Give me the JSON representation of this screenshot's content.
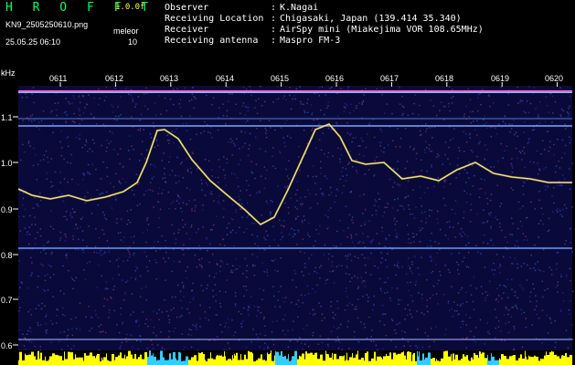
{
  "header": {
    "app_title": "H R O F F T",
    "version": "1.0.0f",
    "filename": "KN9_2505250610.png",
    "timestamp": "25.05.25 06:10",
    "meleor_label": "meleor",
    "meleor_value": "10"
  },
  "info": [
    {
      "label": "Observer",
      "value": "K.Nagai"
    },
    {
      "label": "Receiving Location",
      "value": "Chigasaki, Japan (139.414 35.340)"
    },
    {
      "label": "Receiver",
      "value": "AirSpy mini (Miakejima VOR 108.65MHz)"
    },
    {
      "label": "Receiving antenna",
      "value": "Maspro FM-3"
    }
  ],
  "axis": {
    "y_unit": "kHz",
    "y_ticks": [
      "1.1",
      "1.0",
      "0.9",
      "0.8",
      "0.7",
      "0.6"
    ],
    "x_ticks": [
      "0611",
      "0612",
      "0613",
      "0614",
      "0615",
      "0616",
      "0617",
      "0618",
      "0619",
      "0620"
    ]
  },
  "colors": {
    "background": "#000000",
    "spectrogram_bg": "#0a0a3a",
    "trace": "#ddff44",
    "signal_bar": "#ffff00",
    "title_green": "#00ff66"
  }
}
